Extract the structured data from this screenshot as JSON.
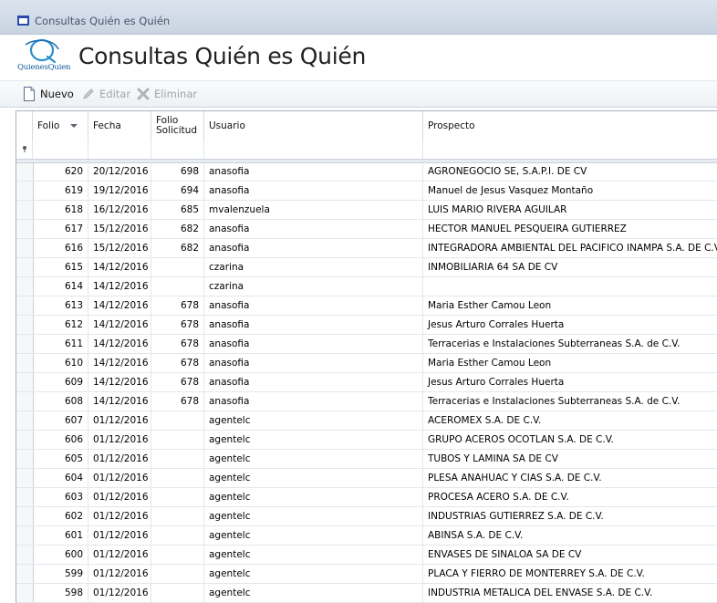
{
  "window": {
    "title": "Consultas Quién es Quién"
  },
  "header": {
    "page_title": "Consultas Quién es Quién",
    "logo_text": "QuienesQuien"
  },
  "toolbar": {
    "nuevo": "Nuevo",
    "editar": "Editar",
    "eliminar": "Eliminar"
  },
  "grid": {
    "columns": [
      "Folio",
      "Fecha",
      "Folio Solicitud",
      "Usuario",
      "Prospecto"
    ],
    "rows": [
      [
        "620",
        "20/12/2016",
        "698",
        "anasofia",
        "AGRONEGOCIO SE, S.A.P.I. DE CV"
      ],
      [
        "619",
        "19/12/2016",
        "694",
        "anasofia",
        " Manuel de Jesus Vasquez Montaño"
      ],
      [
        "618",
        "16/12/2016",
        "685",
        "mvalenzuela",
        " LUIS MARIO RIVERA AGUILAR"
      ],
      [
        "617",
        "15/12/2016",
        "682",
        "anasofia",
        "HECTOR MANUEL PESQUEIRA GUTIERREZ"
      ],
      [
        "616",
        "15/12/2016",
        "682",
        "anasofia",
        "INTEGRADORA AMBIENTAL DEL PACIFICO INAMPA S.A. DE C.V."
      ],
      [
        "615",
        "14/12/2016",
        "",
        "czarina",
        "INMOBILIARIA 64 SA DE CV"
      ],
      [
        "614",
        "14/12/2016",
        "",
        "czarina",
        ""
      ],
      [
        "613",
        "14/12/2016",
        "678",
        "anasofia",
        "Maria Esther Camou Leon"
      ],
      [
        "612",
        "14/12/2016",
        "678",
        "anasofia",
        "Jesus Arturo  Corrales Huerta"
      ],
      [
        "611",
        "14/12/2016",
        "678",
        "anasofia",
        "Terracerias e Instalaciones Subterraneas S.A. de C.V."
      ],
      [
        "610",
        "14/12/2016",
        "678",
        "anasofia",
        "Maria Esther Camou Leon"
      ],
      [
        "609",
        "14/12/2016",
        "678",
        "anasofia",
        "Jesus Arturo  Corrales Huerta"
      ],
      [
        "608",
        "14/12/2016",
        "678",
        "anasofia",
        "Terracerias e Instalaciones Subterraneas S.A. de C.V."
      ],
      [
        "607",
        "01/12/2016",
        "",
        "agentelc",
        "ACEROMEX S.A. DE C.V."
      ],
      [
        "606",
        "01/12/2016",
        "",
        "agentelc",
        "GRUPO ACEROS OCOTLAN S.A. DE C.V."
      ],
      [
        "605",
        "01/12/2016",
        "",
        "agentelc",
        "TUBOS Y LAMINA SA DE CV"
      ],
      [
        "604",
        "01/12/2016",
        "",
        "agentelc",
        "PLESA ANAHUAC Y CIAS S.A. DE C.V."
      ],
      [
        "603",
        "01/12/2016",
        "",
        "agentelc",
        "PROCESA ACERO S.A. DE C.V."
      ],
      [
        "602",
        "01/12/2016",
        "",
        "agentelc",
        "INDUSTRIAS GUTIERREZ S.A. DE C.V."
      ],
      [
        "601",
        "01/12/2016",
        "",
        "agentelc",
        "ABINSA S.A. DE C.V."
      ],
      [
        "600",
        "01/12/2016",
        "",
        "agentelc",
        "ENVASES DE SINALOA SA DE CV"
      ],
      [
        "599",
        "01/12/2016",
        "",
        "agentelc",
        "PLACA Y FIERRO DE MONTERREY S.A. DE C.V."
      ],
      [
        "598",
        "01/12/2016",
        "",
        "agentelc",
        "INDUSTRIA METALICA DEL ENVASE S.A. DE C.V."
      ]
    ]
  },
  "colors": {
    "accent": "#12569a",
    "title_text": "#44546a"
  }
}
